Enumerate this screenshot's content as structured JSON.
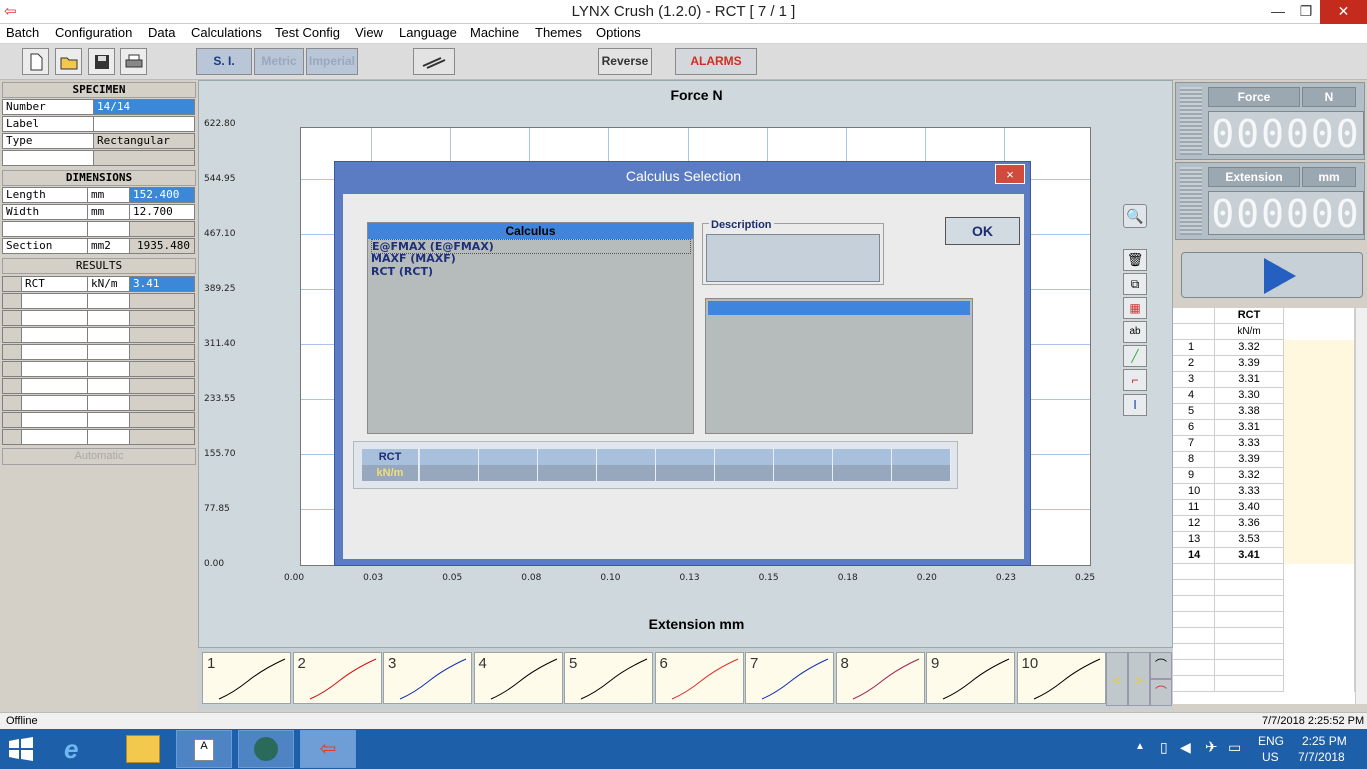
{
  "window": {
    "title": "LYNX Crush  (1.2.0)  -   RCT  [ 7 / 1 ]"
  },
  "menu": [
    "Batch",
    "Configuration",
    "Data",
    "Calculations",
    "Test Config",
    "View",
    "Language",
    "Machine",
    "Themes",
    "Options"
  ],
  "toolbar": {
    "si_label": "S. I.",
    "metric_label": "Metric",
    "imperial_label": "Imperial",
    "reverse_label": "Reverse",
    "alarms_label": "ALARMS"
  },
  "specimen": {
    "header": "SPECIMEN",
    "number_label": "Number",
    "number_value": "14/14",
    "label_label": "Label",
    "label_value": "",
    "type_label": "Type",
    "type_value": "Rectangular"
  },
  "dimensions": {
    "header": "DIMENSIONS",
    "length_label": "Length",
    "length_unit": "mm",
    "length_value": "152.400",
    "width_label": "Width",
    "width_unit": "mm",
    "width_value": "12.700",
    "section_label": "Section",
    "section_unit": "mm2",
    "section_value": "1935.480"
  },
  "results": {
    "header": "RESULTS",
    "name": "RCT",
    "unit": "kN/m",
    "value": "3.41",
    "automatic_label": "Automatic"
  },
  "chart": {
    "title": "Force  N",
    "xlabel": "Extension  mm",
    "y_ticks": [
      "622.80",
      "544.95",
      "467.10",
      "389.25",
      "311.40",
      "233.55",
      "155.70",
      "77.85",
      "0.00"
    ],
    "x_ticks": [
      "0.00",
      "0.03",
      "0.05",
      "0.08",
      "0.10",
      "0.13",
      "0.15",
      "0.18",
      "0.20",
      "0.23",
      "0.25"
    ]
  },
  "dialog": {
    "title": "Calculus Selection",
    "close": "×",
    "calculus_header": "Calculus",
    "calculus_items": [
      "E@FMAX (E@FMAX)",
      "MAXF (MAXF)",
      "RCT (RCT)"
    ],
    "description_label": "Description",
    "ok_label": "OK",
    "strip_name": "RCT",
    "strip_unit": "kN/m"
  },
  "gauges": {
    "force_label": "Force",
    "force_unit": "N",
    "force_value": "000000",
    "ext_label": "Extension",
    "ext_unit": "mm",
    "ext_value": "000000"
  },
  "results_table": {
    "col_name": "RCT",
    "col_unit": "kN/m",
    "rows": [
      [
        "1",
        "3.32"
      ],
      [
        "2",
        "3.39"
      ],
      [
        "3",
        "3.31"
      ],
      [
        "4",
        "3.30"
      ],
      [
        "5",
        "3.38"
      ],
      [
        "6",
        "3.31"
      ],
      [
        "7",
        "3.33"
      ],
      [
        "8",
        "3.39"
      ],
      [
        "9",
        "3.32"
      ],
      [
        "10",
        "3.33"
      ],
      [
        "11",
        "3.40"
      ],
      [
        "12",
        "3.36"
      ],
      [
        "13",
        "3.53"
      ],
      [
        "14",
        "3.41"
      ]
    ]
  },
  "thumbnails": {
    "labels": [
      "1",
      "2",
      "3",
      "4",
      "5",
      "6",
      "7",
      "8",
      "9",
      "10"
    ],
    "colors": [
      "#000000",
      "#d01010",
      "#1030b0",
      "#000000",
      "#000000",
      "#e03030",
      "#1030b0",
      "#a02050",
      "#000000",
      "#000000"
    ]
  },
  "status": {
    "left": "Offline",
    "right": "7/7/2018 2:25:52 PM"
  },
  "taskbar": {
    "lang": "ENG",
    "region": "US",
    "time": "2:25 PM",
    "date": "7/7/2018"
  }
}
